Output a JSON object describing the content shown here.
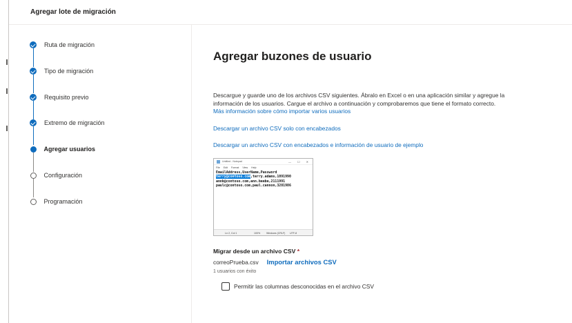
{
  "header": {
    "title": "Agregar lote de migración"
  },
  "steps": [
    {
      "label": "Ruta de migración",
      "state": "done"
    },
    {
      "label": "Tipo de migración",
      "state": "done"
    },
    {
      "label": "Requisito previo",
      "state": "done"
    },
    {
      "label": "Extremo de migración",
      "state": "done"
    },
    {
      "label": "Agregar usuarios",
      "state": "current"
    },
    {
      "label": "Configuración",
      "state": "pending"
    },
    {
      "label": "Programación",
      "state": "pending"
    }
  ],
  "main": {
    "title": "Agregar buzones de usuario",
    "description": "Descargue y guarde uno de los archivos CSV siguientes. Ábralo en Excel o en una aplicación similar y agregue la información de los usuarios. Cargue el archivo a continuación y comprobaremos que tiene el formato correcto.",
    "link_more": "Más información sobre cómo importar varios usuarios",
    "link_csv_headers": "Descargar un archivo CSV solo con encabezados",
    "link_csv_sample": "Descargar un archivo CSV con encabezados e información de usuario de ejemplo",
    "notepad": {
      "title": "Untitled - Notepad",
      "menu": [
        "File",
        "Edit",
        "Format",
        "View",
        "Help"
      ],
      "controls": [
        "—",
        "☐",
        "✕"
      ],
      "line1": "EmailAddress,UserName,Password",
      "line2_highlight": "terry@contoso.com",
      "line2_rest": ",terry.adams,1091990",
      "line3": "annb@contoso.com,ann.beebe,2111991",
      "line4": "paulc@contoso.com,paul.cannon,3281986",
      "status_pos": "Ln 2, Col 1",
      "status_zoom": "100%",
      "status_eol": "Windows (CRLF)",
      "status_enc": "UTF-8"
    },
    "import_label": "Migrar desde un archivo CSV",
    "required_mark": "*",
    "file_name": "correoPrueba.csv",
    "import_button": "Importar archivos CSV",
    "success_text": "1 usuarios con éxito",
    "checkbox_label": "Permitir las columnas desconocidas en el archivo CSV",
    "checkbox_checked": false
  },
  "colors": {
    "accent": "#0f6cbd",
    "required": "#a4262c"
  }
}
